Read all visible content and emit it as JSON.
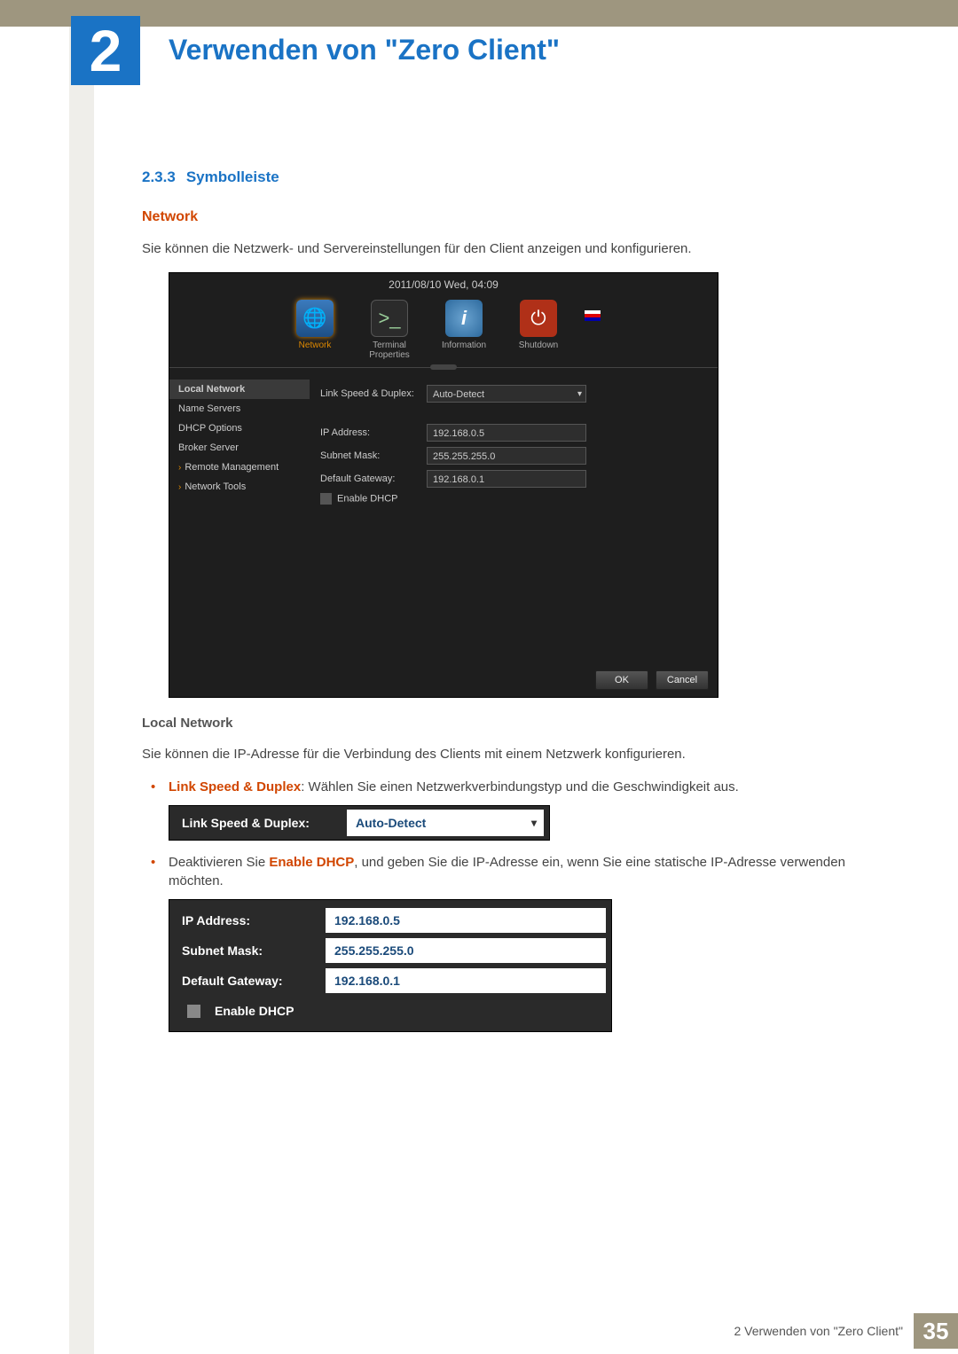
{
  "chapter": {
    "num": "2",
    "title": "Verwenden von \"Zero Client\""
  },
  "section": {
    "num": "2.3.3",
    "title": "Symbolleiste"
  },
  "h_network": "Network",
  "p_intro": "Sie können die Netzwerk- und Servereinstellungen für den Client anzeigen und konfigurieren.",
  "shot": {
    "timestamp": "2011/08/10 Wed, 04:09",
    "tabs": {
      "network": "Network",
      "terminal": "Terminal Properties",
      "info": "Information",
      "shutdown": "Shutdown"
    },
    "side": {
      "local": "Local Network",
      "name": "Name Servers",
      "dhcp": "DHCP Options",
      "broker": "Broker Server",
      "remote": "Remote Management",
      "tools": "Network Tools"
    },
    "form": {
      "lsd_label": "Link Speed & Duplex:",
      "lsd_value": "Auto-Detect",
      "ip_label": "IP Address:",
      "ip_value": "192.168.0.5",
      "sm_label": "Subnet Mask:",
      "sm_value": "255.255.255.0",
      "gw_label": "Default Gateway:",
      "gw_value": "192.168.0.1",
      "dhcp_label": "Enable DHCP"
    },
    "ok": "OK",
    "cancel": "Cancel"
  },
  "h_local": "Local Network",
  "p_local": "Sie können die IP-Adresse für die Verbindung des Clients mit einem Netzwerk konfigurieren.",
  "li1a": "Link Speed & Duplex",
  "li1b": ": Wählen Sie einen Netzwerkverbindungstyp und die Geschwindigkeit aus.",
  "li2a": "Deaktivieren Sie ",
  "li2b": "Enable DHCP",
  "li2c": ", und geben Sie die IP-Adresse ein, wenn Sie eine statische IP-Adresse verwenden möchten.",
  "crop1": {
    "label": "Link Speed & Duplex:",
    "value": "Auto-Detect"
  },
  "crop2": {
    "ip_label": "IP Address:",
    "ip_value": "192.168.0.5",
    "sm_label": "Subnet Mask:",
    "sm_value": "255.255.255.0",
    "gw_label": "Default Gateway:",
    "gw_value": "192.168.0.1",
    "dhcp_label": "Enable DHCP"
  },
  "footer": {
    "text": "2 Verwenden von \"Zero Client\"",
    "page": "35"
  }
}
